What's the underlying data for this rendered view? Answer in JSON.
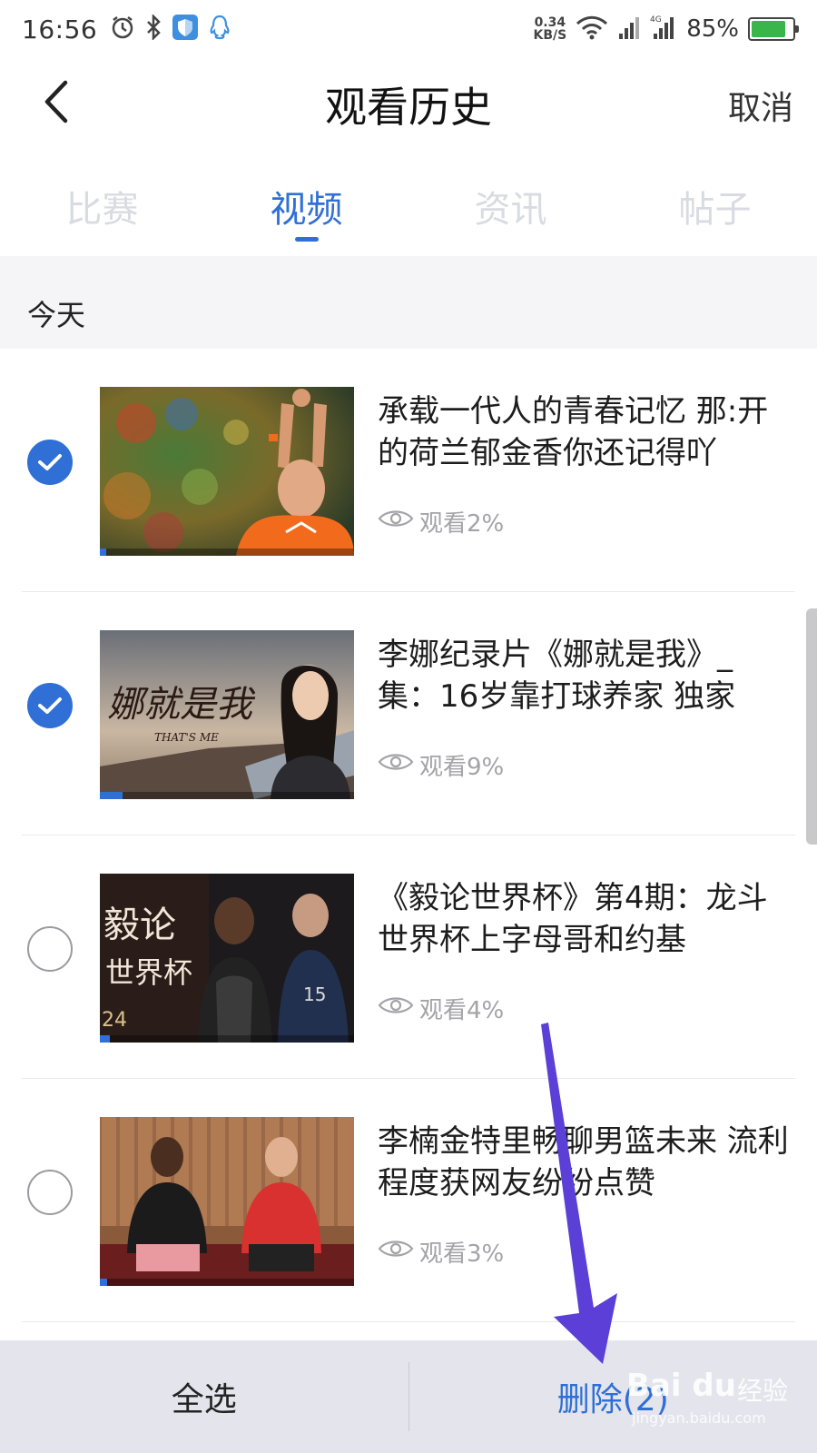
{
  "status_bar": {
    "time": "16:56",
    "net_speed_value": "0.34",
    "net_speed_unit": "KB/S",
    "battery_percent": "85%",
    "battery_level": 0.85,
    "icons": [
      "alarm-icon",
      "bluetooth-icon",
      "shield-icon",
      "qq-icon",
      "wifi-icon",
      "signal-icon",
      "signal-4g-icon",
      "battery-icon"
    ]
  },
  "header": {
    "title": "观看历史",
    "cancel_label": "取消",
    "back_icon": "chevron-left-icon"
  },
  "tabs": [
    {
      "label": "比赛",
      "active": false
    },
    {
      "label": "视频",
      "active": true
    },
    {
      "label": "资讯",
      "active": false
    },
    {
      "label": "帖子",
      "active": false
    }
  ],
  "section": {
    "label": "今天"
  },
  "items": [
    {
      "title": "承载一代人的青春记忆 那:开的荷兰郁金香你还记得吖",
      "watch_text": "观看2%",
      "progress": 0.02,
      "checked": true
    },
    {
      "title": "李娜纪录片《娜就是我》_集：16岁靠打球养家 独家",
      "watch_text": "观看9%",
      "progress": 0.09,
      "checked": true
    },
    {
      "title": "《毅论世界杯》第4期：龙斗 世界杯上字母哥和约基",
      "watch_text": "观看4%",
      "progress": 0.04,
      "checked": false
    },
    {
      "title": "李楠金特里畅聊男篮未来 流利程度获网友纷纷点赞",
      "watch_text": "观看3%",
      "progress": 0.03,
      "checked": false
    }
  ],
  "thumb_text": {
    "item2_script": "娜就是我",
    "item2_sub": "THAT'S ME",
    "item3_script1": "毅论",
    "item3_script2": "世界杯",
    "item3_num": "24",
    "item3_jersey": "15"
  },
  "bottom_bar": {
    "select_all_label": "全选",
    "delete_label": "删除(2)"
  },
  "watermark": {
    "brand": "Bai du",
    "label": "经验",
    "url": "jingyan.baidu.com"
  },
  "colors": {
    "accent": "#2f6fd6",
    "annotation_arrow": "#5b3fd6"
  }
}
